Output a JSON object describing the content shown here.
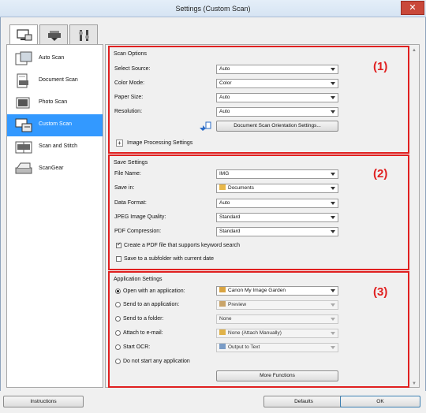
{
  "window": {
    "title": "Settings (Custom Scan)",
    "close_glyph": "✕"
  },
  "tabs": [
    {
      "icon": "scan-from-computer-icon",
      "active": true
    },
    {
      "icon": "scanner-icon",
      "active": false
    },
    {
      "icon": "general-settings-icon",
      "active": false
    }
  ],
  "sidebar": {
    "items": [
      {
        "label": "Auto Scan",
        "icon": "auto-scan-icon"
      },
      {
        "label": "Document Scan",
        "icon": "document-scan-icon"
      },
      {
        "label": "Photo Scan",
        "icon": "photo-scan-icon"
      },
      {
        "label": "Custom Scan",
        "icon": "custom-scan-icon",
        "selected": true
      },
      {
        "label": "Scan and Stitch",
        "icon": "scan-and-stitch-icon"
      },
      {
        "label": "ScanGear",
        "icon": "scangear-icon"
      }
    ]
  },
  "scan_options": {
    "title": "Scan Options",
    "number": "(1)",
    "source_label": "Select Source:",
    "source_value": "Auto",
    "color_label": "Color Mode:",
    "color_value": "Color",
    "paper_label": "Paper Size:",
    "paper_value": "Auto",
    "resolution_label": "Resolution:",
    "resolution_value": "Auto",
    "orientation_button": "Document Scan Orientation Settings...",
    "image_processing_label": "Image Processing Settings",
    "expand_glyph": "+"
  },
  "save_settings": {
    "title": "Save Settings",
    "number": "(2)",
    "filename_label": "File Name:",
    "filename_value": "IMG",
    "savein_label": "Save in:",
    "savein_value": "Documents",
    "format_label": "Data Format:",
    "format_value": "Auto",
    "jpeg_label": "JPEG Image Quality:",
    "jpeg_value": "Standard",
    "pdf_label": "PDF Compression:",
    "pdf_value": "Standard",
    "keyword_pdf_label": "Create a PDF file that supports keyword search",
    "keyword_pdf_checked": true,
    "subfolder_label": "Save to a subfolder with current date",
    "subfolder_checked": false
  },
  "app_settings": {
    "title": "Application Settings",
    "number": "(3)",
    "open_label": "Open with an application:",
    "open_value": "Canon My Image Garden",
    "send_app_label": "Send to an application:",
    "send_app_value": "Preview",
    "send_folder_label": "Send to a folder:",
    "send_folder_value": "None",
    "email_label": "Attach to e-mail:",
    "email_value": "None (Attach Manually)",
    "ocr_label": "Start OCR:",
    "ocr_value": "Output to Text",
    "noapp_label": "Do not start any application",
    "selected_option": "open_with_application",
    "more_button": "More Functions"
  },
  "footer": {
    "instructions": "Instructions",
    "defaults": "Defaults",
    "ok": "OK"
  },
  "colors": {
    "selection": "#3399ff",
    "highlight_border": "#e02020"
  }
}
